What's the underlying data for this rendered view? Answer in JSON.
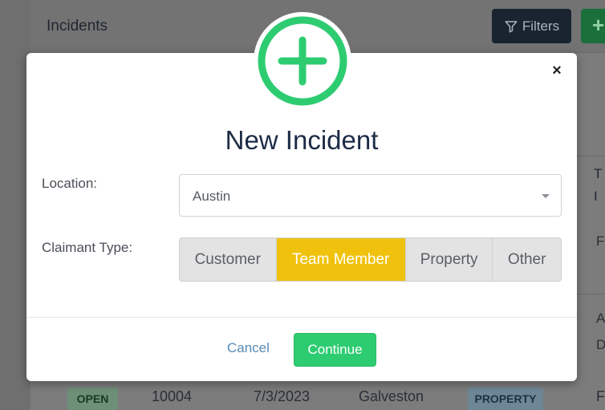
{
  "background": {
    "page_title": "Incidents",
    "filters_label": "Filters",
    "add_label": "+",
    "column_header_partial": "T\nI",
    "cells_partial": [
      "F",
      "A",
      "D"
    ],
    "row": {
      "status": "OPEN",
      "id": "10004",
      "date": "7/3/2023",
      "location": "Galveston",
      "type": "PROPERTY",
      "extra": "F"
    }
  },
  "modal": {
    "title": "New Incident",
    "close_label": "×",
    "location_label": "Location:",
    "location_value": "Austin",
    "claimant_label": "Claimant Type:",
    "claimant_options": [
      "Customer",
      "Team Member",
      "Property",
      "Other"
    ],
    "claimant_selected": "Team Member",
    "cancel_label": "Cancel",
    "continue_label": "Continue"
  },
  "colors": {
    "accent_green": "#2ecc71",
    "selected_yellow": "#f0c20e",
    "title_navy": "#1d2b45"
  }
}
